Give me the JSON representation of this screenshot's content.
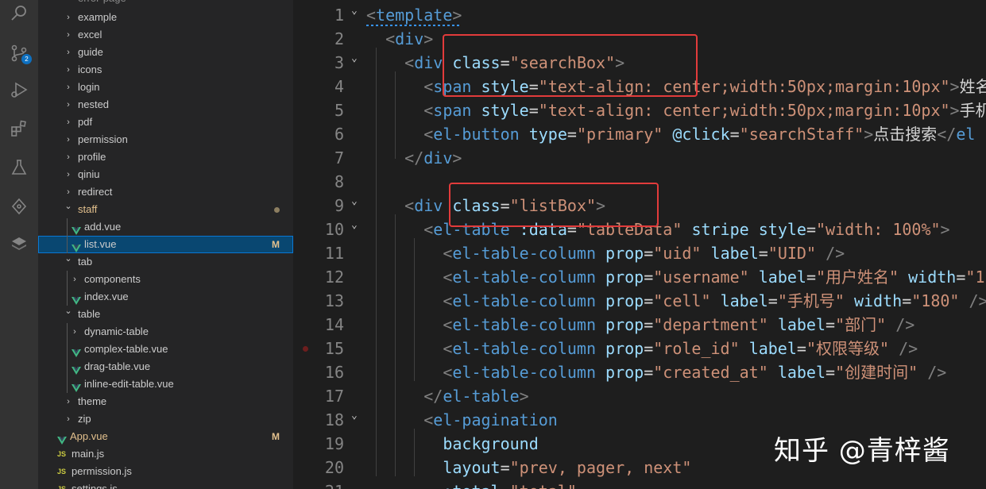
{
  "activity_bar": {
    "items": [
      {
        "name": "search-icon"
      },
      {
        "name": "source-control-icon",
        "badge": "2"
      },
      {
        "name": "run-debug-icon"
      },
      {
        "name": "extensions-icon"
      },
      {
        "name": "testing-icon"
      },
      {
        "name": "gitlens-icon"
      },
      {
        "name": "layers-icon"
      }
    ]
  },
  "explorer": {
    "top_partial": "error-page",
    "rows": [
      {
        "label": "example",
        "kind": "folder",
        "collapsed": true,
        "level": 1
      },
      {
        "label": "excel",
        "kind": "folder",
        "collapsed": true,
        "level": 1
      },
      {
        "label": "guide",
        "kind": "folder",
        "collapsed": true,
        "level": 1
      },
      {
        "label": "icons",
        "kind": "folder",
        "collapsed": true,
        "level": 1
      },
      {
        "label": "login",
        "kind": "folder",
        "collapsed": true,
        "level": 1
      },
      {
        "label": "nested",
        "kind": "folder",
        "collapsed": true,
        "level": 1
      },
      {
        "label": "pdf",
        "kind": "folder",
        "collapsed": true,
        "level": 1
      },
      {
        "label": "permission",
        "kind": "folder",
        "collapsed": true,
        "level": 1
      },
      {
        "label": "profile",
        "kind": "folder",
        "collapsed": true,
        "level": 1
      },
      {
        "label": "qiniu",
        "kind": "folder",
        "collapsed": true,
        "level": 1
      },
      {
        "label": "redirect",
        "kind": "folder",
        "collapsed": true,
        "level": 1
      },
      {
        "label": "staff",
        "kind": "folder",
        "collapsed": false,
        "level": 1,
        "modified": true,
        "status": "dot"
      },
      {
        "label": "add.vue",
        "kind": "vue",
        "level": 2
      },
      {
        "label": "list.vue",
        "kind": "vue",
        "level": 2,
        "selected": true,
        "status": "M"
      },
      {
        "label": "tab",
        "kind": "folder",
        "collapsed": false,
        "level": 1
      },
      {
        "label": "components",
        "kind": "folder",
        "collapsed": true,
        "level": 2
      },
      {
        "label": "index.vue",
        "kind": "vue",
        "level": 2
      },
      {
        "label": "table",
        "kind": "folder",
        "collapsed": false,
        "level": 1
      },
      {
        "label": "dynamic-table",
        "kind": "folder",
        "collapsed": true,
        "level": 2
      },
      {
        "label": "complex-table.vue",
        "kind": "vue",
        "level": 2
      },
      {
        "label": "drag-table.vue",
        "kind": "vue",
        "level": 2
      },
      {
        "label": "inline-edit-table.vue",
        "kind": "vue",
        "level": 2
      },
      {
        "label": "theme",
        "kind": "folder",
        "collapsed": true,
        "level": 1
      },
      {
        "label": "zip",
        "kind": "folder",
        "collapsed": true,
        "level": 1
      },
      {
        "label": "App.vue",
        "kind": "vue",
        "level": 0,
        "modified": true,
        "status": "M"
      },
      {
        "label": "main.js",
        "kind": "js",
        "level": 0
      },
      {
        "label": "permission.js",
        "kind": "js",
        "level": 0
      },
      {
        "label": "settings.js",
        "kind": "js",
        "level": 0
      }
    ]
  },
  "editor": {
    "colors": {
      "tag": "#569cd6",
      "attr": "#9cdcfe",
      "string": "#ce9178",
      "punct": "#808080",
      "text": "#d4d4d4",
      "highlight_box": "#e23b3b"
    },
    "lines": [
      {
        "n": "1",
        "fold": true,
        "tokens": [
          [
            "p",
            "<"
          ],
          [
            "t",
            "template"
          ],
          [
            "p",
            ">"
          ]
        ]
      },
      {
        "n": "2",
        "fold": false,
        "tokens": [
          [
            "x",
            "  "
          ],
          [
            "p",
            "<"
          ],
          [
            "t",
            "div"
          ],
          [
            "p",
            ">"
          ]
        ]
      },
      {
        "n": "3",
        "fold": true,
        "tokens": [
          [
            "x",
            "    "
          ],
          [
            "p",
            "<"
          ],
          [
            "t",
            "div"
          ],
          [
            "x",
            " "
          ],
          [
            "a",
            "class"
          ],
          [
            "x",
            "="
          ],
          [
            "s",
            "\"searchBox\""
          ],
          [
            "p",
            ">"
          ]
        ]
      },
      {
        "n": "4",
        "fold": false,
        "tokens": [
          [
            "x",
            "      "
          ],
          [
            "p",
            "<"
          ],
          [
            "t",
            "span"
          ],
          [
            "x",
            " "
          ],
          [
            "a",
            "style"
          ],
          [
            "x",
            "="
          ],
          [
            "s",
            "\"text-align: center;width:50px;margin:10px\""
          ],
          [
            "p",
            ">"
          ],
          [
            "x",
            "姓名"
          ]
        ]
      },
      {
        "n": "5",
        "fold": false,
        "tokens": [
          [
            "x",
            "      "
          ],
          [
            "p",
            "<"
          ],
          [
            "t",
            "span"
          ],
          [
            "x",
            " "
          ],
          [
            "a",
            "style"
          ],
          [
            "x",
            "="
          ],
          [
            "s",
            "\"text-align: center;width:50px;margin:10px\""
          ],
          [
            "p",
            ">"
          ],
          [
            "x",
            "手机"
          ]
        ]
      },
      {
        "n": "6",
        "fold": false,
        "tokens": [
          [
            "x",
            "      "
          ],
          [
            "p",
            "<"
          ],
          [
            "t",
            "el-button"
          ],
          [
            "x",
            " "
          ],
          [
            "a",
            "type"
          ],
          [
            "x",
            "="
          ],
          [
            "s",
            "\"primary\""
          ],
          [
            "x",
            " "
          ],
          [
            "a",
            "@click"
          ],
          [
            "x",
            "="
          ],
          [
            "s",
            "\"searchStaff\""
          ],
          [
            "p",
            ">"
          ],
          [
            "x",
            "点击搜索"
          ],
          [
            "p",
            "</"
          ],
          [
            "t",
            "el"
          ]
        ]
      },
      {
        "n": "7",
        "fold": false,
        "tokens": [
          [
            "x",
            "    "
          ],
          [
            "p",
            "</"
          ],
          [
            "t",
            "div"
          ],
          [
            "p",
            ">"
          ]
        ]
      },
      {
        "n": "8",
        "fold": false,
        "tokens": []
      },
      {
        "n": "9",
        "fold": true,
        "tokens": [
          [
            "x",
            "    "
          ],
          [
            "p",
            "<"
          ],
          [
            "t",
            "div"
          ],
          [
            "x",
            " "
          ],
          [
            "a",
            "class"
          ],
          [
            "x",
            "="
          ],
          [
            "s",
            "\"listBox\""
          ],
          [
            "p",
            ">"
          ]
        ]
      },
      {
        "n": "10",
        "fold": true,
        "tokens": [
          [
            "x",
            "      "
          ],
          [
            "p",
            "<"
          ],
          [
            "t",
            "el-table"
          ],
          [
            "x",
            " "
          ],
          [
            "a",
            ":data"
          ],
          [
            "x",
            "="
          ],
          [
            "s",
            "\"tableData\""
          ],
          [
            "x",
            " "
          ],
          [
            "a",
            "stripe"
          ],
          [
            "x",
            " "
          ],
          [
            "a",
            "style"
          ],
          [
            "x",
            "="
          ],
          [
            "s",
            "\"width: 100%\""
          ],
          [
            "p",
            ">"
          ]
        ]
      },
      {
        "n": "11",
        "fold": false,
        "tokens": [
          [
            "x",
            "        "
          ],
          [
            "p",
            "<"
          ],
          [
            "t",
            "el-table-column"
          ],
          [
            "x",
            " "
          ],
          [
            "a",
            "prop"
          ],
          [
            "x",
            "="
          ],
          [
            "s",
            "\"uid\""
          ],
          [
            "x",
            " "
          ],
          [
            "a",
            "label"
          ],
          [
            "x",
            "="
          ],
          [
            "s",
            "\"UID\""
          ],
          [
            "x",
            " "
          ],
          [
            "p",
            "/>"
          ]
        ]
      },
      {
        "n": "12",
        "fold": false,
        "tokens": [
          [
            "x",
            "        "
          ],
          [
            "p",
            "<"
          ],
          [
            "t",
            "el-table-column"
          ],
          [
            "x",
            " "
          ],
          [
            "a",
            "prop"
          ],
          [
            "x",
            "="
          ],
          [
            "s",
            "\"username\""
          ],
          [
            "x",
            " "
          ],
          [
            "a",
            "label"
          ],
          [
            "x",
            "="
          ],
          [
            "s",
            "\"用户姓名\""
          ],
          [
            "x",
            " "
          ],
          [
            "a",
            "width"
          ],
          [
            "x",
            "="
          ],
          [
            "s",
            "\"1"
          ]
        ]
      },
      {
        "n": "13",
        "fold": false,
        "tokens": [
          [
            "x",
            "        "
          ],
          [
            "p",
            "<"
          ],
          [
            "t",
            "el-table-column"
          ],
          [
            "x",
            " "
          ],
          [
            "a",
            "prop"
          ],
          [
            "x",
            "="
          ],
          [
            "s",
            "\"cell\""
          ],
          [
            "x",
            " "
          ],
          [
            "a",
            "label"
          ],
          [
            "x",
            "="
          ],
          [
            "s",
            "\"手机号\""
          ],
          [
            "x",
            " "
          ],
          [
            "a",
            "width"
          ],
          [
            "x",
            "="
          ],
          [
            "s",
            "\"180\""
          ],
          [
            "x",
            " "
          ],
          [
            "p",
            "/>"
          ]
        ]
      },
      {
        "n": "14",
        "fold": false,
        "tokens": [
          [
            "x",
            "        "
          ],
          [
            "p",
            "<"
          ],
          [
            "t",
            "el-table-column"
          ],
          [
            "x",
            " "
          ],
          [
            "a",
            "prop"
          ],
          [
            "x",
            "="
          ],
          [
            "s",
            "\"department\""
          ],
          [
            "x",
            " "
          ],
          [
            "a",
            "label"
          ],
          [
            "x",
            "="
          ],
          [
            "s",
            "\"部门\""
          ],
          [
            "x",
            " "
          ],
          [
            "p",
            "/>"
          ]
        ]
      },
      {
        "n": "15",
        "fold": false,
        "breakpoint": true,
        "tokens": [
          [
            "x",
            "        "
          ],
          [
            "p",
            "<"
          ],
          [
            "t",
            "el-table-column"
          ],
          [
            "x",
            " "
          ],
          [
            "a",
            "prop"
          ],
          [
            "x",
            "="
          ],
          [
            "s",
            "\"role_id\""
          ],
          [
            "x",
            " "
          ],
          [
            "a",
            "label"
          ],
          [
            "x",
            "="
          ],
          [
            "s",
            "\"权限等级\""
          ],
          [
            "x",
            " "
          ],
          [
            "p",
            "/>"
          ]
        ]
      },
      {
        "n": "16",
        "fold": false,
        "tokens": [
          [
            "x",
            "        "
          ],
          [
            "p",
            "<"
          ],
          [
            "t",
            "el-table-column"
          ],
          [
            "x",
            " "
          ],
          [
            "a",
            "prop"
          ],
          [
            "x",
            "="
          ],
          [
            "s",
            "\"created_at\""
          ],
          [
            "x",
            " "
          ],
          [
            "a",
            "label"
          ],
          [
            "x",
            "="
          ],
          [
            "s",
            "\"创建时间\""
          ],
          [
            "x",
            " "
          ],
          [
            "p",
            "/>"
          ]
        ]
      },
      {
        "n": "17",
        "fold": false,
        "tokens": [
          [
            "x",
            "      "
          ],
          [
            "p",
            "</"
          ],
          [
            "t",
            "el-table"
          ],
          [
            "p",
            ">"
          ]
        ]
      },
      {
        "n": "18",
        "fold": true,
        "tokens": [
          [
            "x",
            "      "
          ],
          [
            "p",
            "<"
          ],
          [
            "t",
            "el-pagination"
          ]
        ]
      },
      {
        "n": "19",
        "fold": false,
        "tokens": [
          [
            "x",
            "        "
          ],
          [
            "a",
            "background"
          ]
        ]
      },
      {
        "n": "20",
        "fold": false,
        "tokens": [
          [
            "x",
            "        "
          ],
          [
            "a",
            "layout"
          ],
          [
            "x",
            "="
          ],
          [
            "s",
            "\"prev, pager, next\""
          ]
        ]
      },
      {
        "n": "21",
        "fold": false,
        "tokens": [
          [
            "x",
            "        "
          ],
          [
            "a",
            ":total"
          ],
          [
            "x",
            "="
          ],
          [
            "s",
            "\"total\""
          ]
        ]
      }
    ]
  },
  "watermark": "知乎 @青梓酱"
}
